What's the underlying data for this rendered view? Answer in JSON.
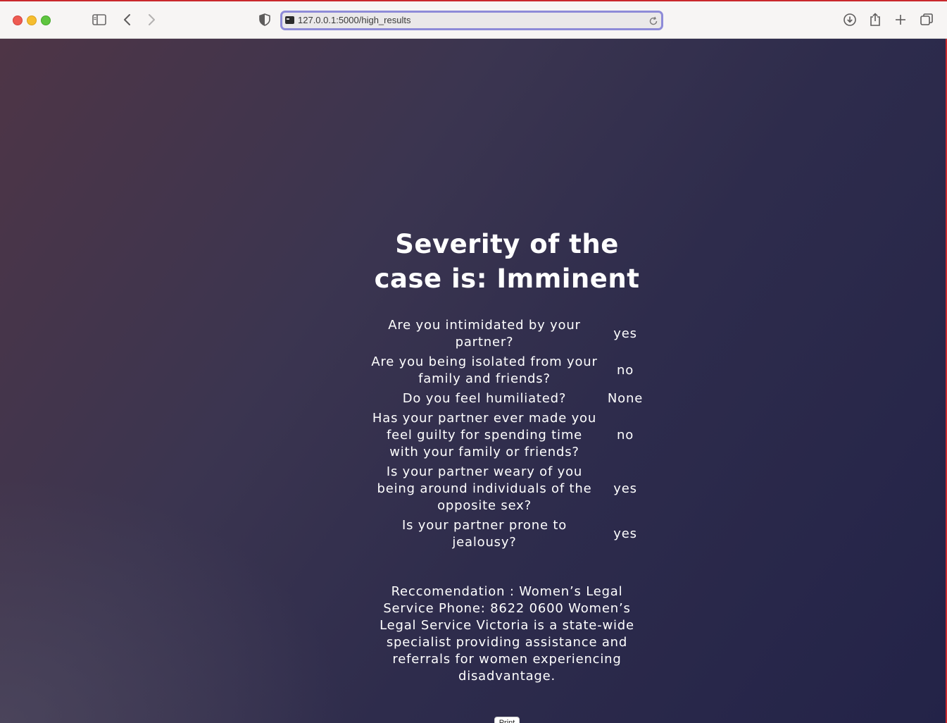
{
  "browser": {
    "url": "127.0.0.1:5000/high_results"
  },
  "page": {
    "title": "Severity of the case is: Imminent",
    "answers": [
      {
        "question": "Are you intimidated by your partner?",
        "answer": "yes"
      },
      {
        "question": "Are you being isolated from your family and friends?",
        "answer": "no"
      },
      {
        "question": "Do you feel humiliated?",
        "answer": "None"
      },
      {
        "question": "Has your partner ever made you feel guilty for spending time with your family or friends?",
        "answer": "no"
      },
      {
        "question": "Is your partner weary of you being around individuals of the opposite sex?",
        "answer": "yes"
      },
      {
        "question": "Is your partner prone to jealousy?",
        "answer": "yes"
      }
    ],
    "recommendation": "Reccomendation : Women’s Legal Service Phone: 8622 0600 Women’s Legal Service Victoria is a state-wide specialist providing assistance and referrals for women experiencing disadvantage.",
    "print_label": "Print"
  },
  "icons": {
    "sidebar": "sidebar-icon",
    "back": "chevron-left-icon",
    "forward": "chevron-right-icon",
    "shield": "shield-icon",
    "reload": "reload-icon",
    "download": "download-icon",
    "share": "share-icon",
    "new_tab": "plus-icon",
    "tabs": "tab-overview-icon"
  },
  "colors": {
    "address_focus": "#8e8bd8",
    "page_bg_start": "#4e3546",
    "page_bg_end": "#232348"
  }
}
